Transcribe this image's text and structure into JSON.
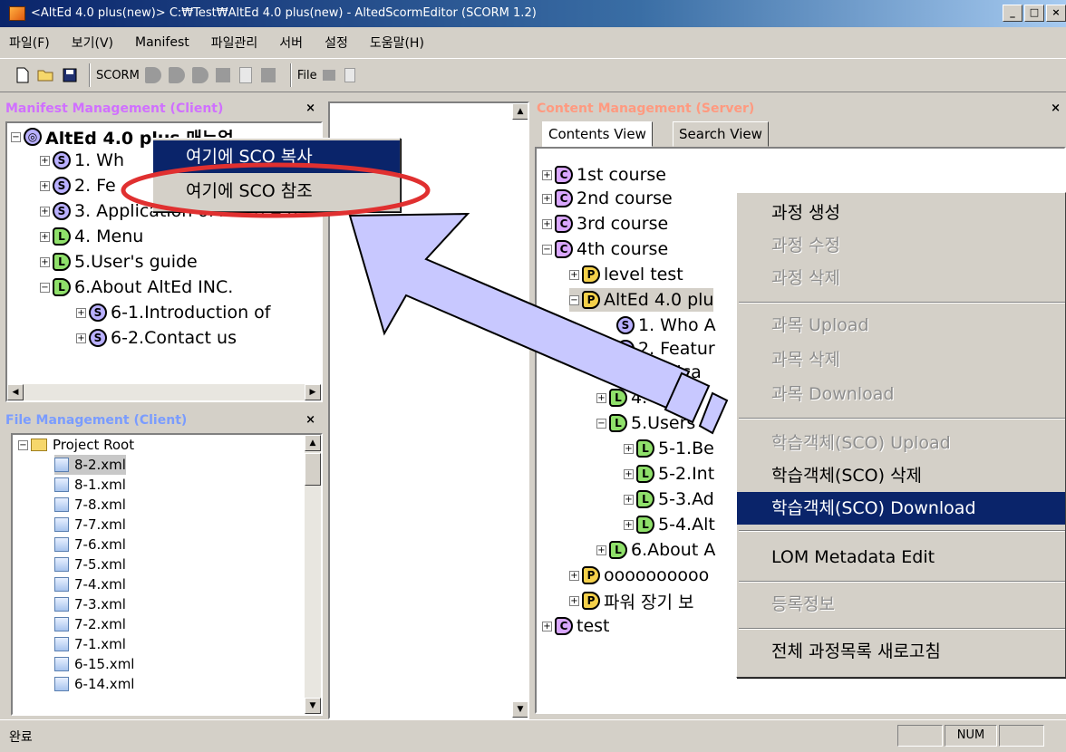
{
  "window": {
    "title": "<AltEd 4.0 plus(new)> C:₩Test₩AltEd 4.0 plus(new) - AltedScormEditor (SCORM 1.2)",
    "buttons": [
      "_",
      "□",
      "×"
    ]
  },
  "menubar": [
    "파일(F)",
    "보기(V)",
    "Manifest",
    "파일관리",
    "서버",
    "설정",
    "도움말(H)"
  ],
  "toolbar": {
    "scorm_label": "SCORM",
    "file_label": "File"
  },
  "manifest_panel": {
    "title": "Manifest Management (Client)",
    "close": "×",
    "root": "AltEd 4.0 plus 매뉴얼",
    "items": [
      {
        "text": "1. Wh",
        "icon": "S"
      },
      {
        "text": "2. Fe",
        "icon": "S"
      },
      {
        "text": "3. Application of AltEd 4.0",
        "icon": "S"
      },
      {
        "text": "4. Menu",
        "icon": "L"
      },
      {
        "text": "5.User's guide",
        "icon": "L"
      },
      {
        "text": "6.About AltEd INC.",
        "icon": "L"
      },
      {
        "text": "6-1.Introduction of",
        "icon": "S"
      },
      {
        "text": "6-2.Contact us",
        "icon": "S"
      }
    ]
  },
  "sco_menu": {
    "items": [
      "여기에 SCO 복사",
      "여기에 SCO 참조"
    ]
  },
  "file_panel": {
    "title": "File Management (Client)",
    "close": "×",
    "root": "Project Root",
    "files": [
      "8-2.xml",
      "8-1.xml",
      "7-8.xml",
      "7-7.xml",
      "7-6.xml",
      "7-5.xml",
      "7-4.xml",
      "7-3.xml",
      "7-2.xml",
      "7-1.xml",
      "6-15.xml",
      "6-14.xml"
    ]
  },
  "content_panel": {
    "title": "Content Management (Server)",
    "close": "×",
    "tabs": [
      "Contents View",
      "Search View"
    ],
    "tree": [
      {
        "text": "1st course",
        "icon": "C"
      },
      {
        "text": "2nd course",
        "icon": "C"
      },
      {
        "text": "3rd course",
        "icon": "C"
      },
      {
        "text": "4th course",
        "icon": "C"
      },
      {
        "text": "level test",
        "icon": "P"
      },
      {
        "text": "AltEd 4.0 plu",
        "icon": "P"
      },
      {
        "text": "1. Who A",
        "icon": "S"
      },
      {
        "text": "2. Featur",
        "icon": "S"
      },
      {
        "text": "Applica",
        "icon": "S"
      },
      {
        "text": "4. Menu",
        "icon": "L"
      },
      {
        "text": "5.Users",
        "icon": "L"
      },
      {
        "text": "5-1.Be",
        "icon": "L"
      },
      {
        "text": "5-2.Int",
        "icon": "L"
      },
      {
        "text": "5-3.Ad",
        "icon": "L"
      },
      {
        "text": "5-4.Alt",
        "icon": "L"
      },
      {
        "text": "6.About A",
        "icon": "L"
      },
      {
        "text": "oooooooooo",
        "icon": "P"
      },
      {
        "text": "파워 장기 보",
        "icon": "P"
      },
      {
        "text": "test",
        "icon": "C"
      }
    ]
  },
  "context_menu": {
    "items": [
      {
        "label": "과정 생성",
        "state": "enabled"
      },
      {
        "label": "과정 수정",
        "state": "disabled"
      },
      {
        "label": "과정 삭제",
        "state": "disabled"
      },
      {
        "label": "과목 Upload",
        "state": "disabled"
      },
      {
        "label": "과목 삭제",
        "state": "disabled"
      },
      {
        "label": "과목 Download",
        "state": "disabled"
      },
      {
        "label": "학습객체(SCO) Upload",
        "state": "disabled"
      },
      {
        "label": "학습객체(SCO) 삭제",
        "state": "enabled"
      },
      {
        "label": "학습객체(SCO) Download",
        "state": "highlighted"
      },
      {
        "label": "LOM Metadata Edit",
        "state": "enabled"
      },
      {
        "label": "등록정보",
        "state": "disabled"
      },
      {
        "label": "전체 과정목록 새로고침",
        "state": "enabled"
      }
    ]
  },
  "statusbar": {
    "text": "완료",
    "num": "NUM"
  },
  "colors": {
    "panel_title": "#d070ff",
    "content_title": "#ff9a80",
    "file_title": "#7a9cff",
    "highlight": "#0a246a",
    "annotation_ellipse": "#e03030",
    "annotation_arrow": "#c8c8ff"
  }
}
